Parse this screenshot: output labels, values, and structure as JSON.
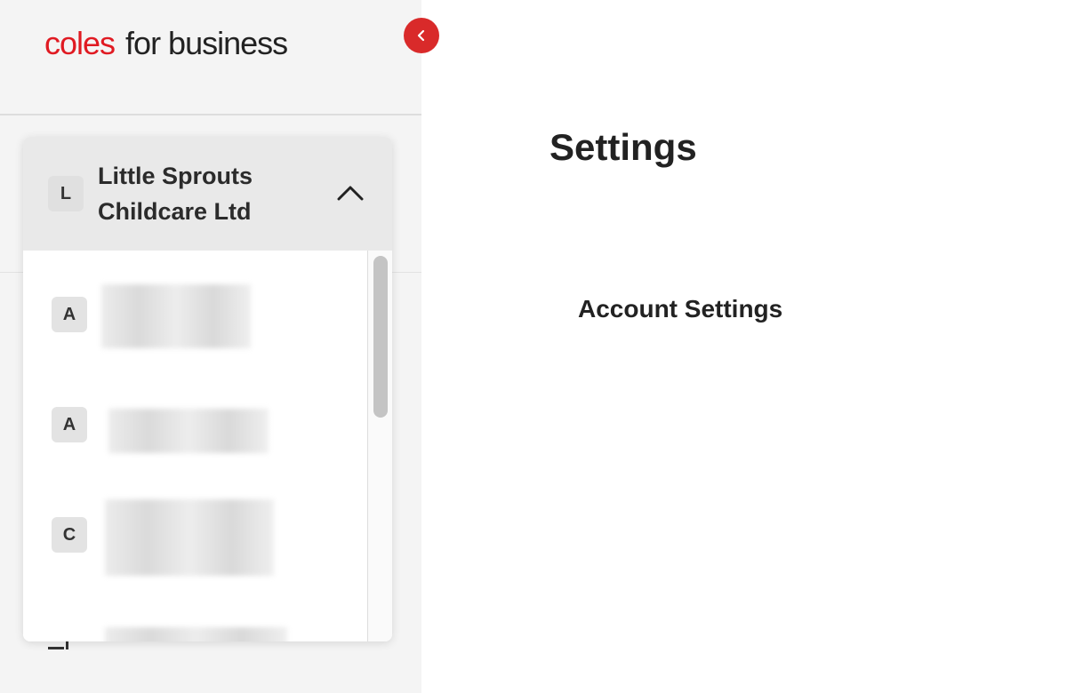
{
  "logo": {
    "brand": "coles",
    "rest": "for business"
  },
  "sidebar": {
    "collapse_label": "‹",
    "account": {
      "initial": "L",
      "name": "Little Sprouts Childcare Ltd"
    },
    "accounts_list": [
      {
        "initial": "A"
      },
      {
        "initial": "A"
      },
      {
        "initial": "C"
      }
    ]
  },
  "main": {
    "title": "Settings",
    "link": "Account Settings"
  },
  "colors": {
    "brand_red": "#e01a22",
    "collapse_button": "#d92a2a"
  }
}
